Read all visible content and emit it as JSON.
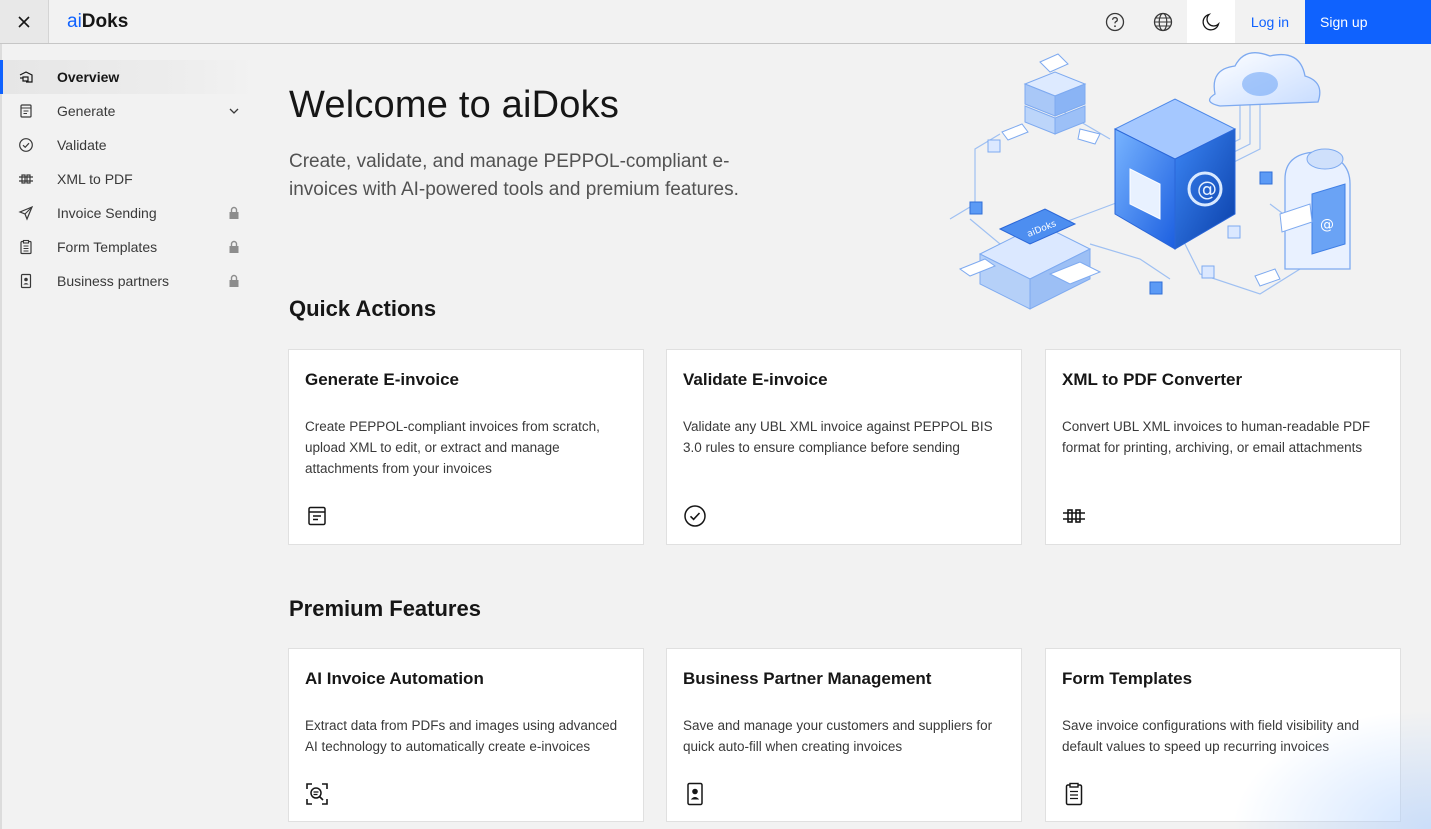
{
  "header": {
    "brand_prefix": "ai",
    "brand_name": "Doks",
    "login_label": "Log in",
    "signup_label": "Sign up",
    "icons": [
      "close-icon",
      "help-icon",
      "globe-icon",
      "moon-icon"
    ]
  },
  "sidebar": {
    "items": [
      {
        "label": "Overview",
        "icon": "overview-icon",
        "active": true
      },
      {
        "label": "Generate",
        "icon": "document-icon",
        "trailing": "chevron-down-icon"
      },
      {
        "label": "Validate",
        "icon": "checkmark-circle-icon"
      },
      {
        "label": "XML to PDF",
        "icon": "convert-icon"
      },
      {
        "label": "Invoice Sending",
        "icon": "send-icon",
        "trailing": "lock-icon"
      },
      {
        "label": "Form Templates",
        "icon": "clipboard-icon",
        "trailing": "lock-icon"
      },
      {
        "label": "Business partners",
        "icon": "contact-card-icon",
        "trailing": "lock-icon"
      }
    ]
  },
  "main": {
    "title": "Welcome to aiDoks",
    "subtitle": "Create, validate, and manage PEPPOL-compliant e-invoices with AI-powered tools and premium features.",
    "quick_actions_title": "Quick Actions",
    "premium_title": "Premium Features",
    "quick_actions": [
      {
        "title": "Generate E-invoice",
        "desc": "Create PEPPOL-compliant invoices from scratch, upload XML to edit, or extract and manage attachments from your invoices",
        "icon": "document-icon"
      },
      {
        "title": "Validate E-invoice",
        "desc": "Validate any UBL XML invoice against PEPPOL BIS 3.0 rules to ensure compliance before sending",
        "icon": "checkmark-circle-icon"
      },
      {
        "title": "XML to PDF Converter",
        "desc": "Convert UBL XML invoices to human-readable PDF format for printing, archiving, or email attachments",
        "icon": "convert-icon"
      }
    ],
    "premium_features": [
      {
        "title": "AI Invoice Automation",
        "desc": "Extract data from PDFs and images using advanced AI technology to automatically create e-invoices",
        "icon": "scan-document-icon"
      },
      {
        "title": "Business Partner Management",
        "desc": "Save and manage your customers and suppliers for quick auto-fill when creating invoices",
        "icon": "contact-card-icon"
      },
      {
        "title": "Form Templates",
        "desc": "Save invoice configurations with field visibility and default values to speed up recurring invoices",
        "icon": "clipboard-icon"
      }
    ],
    "hero_label": "aiDoks"
  },
  "colors": {
    "accent": "#0f62fe",
    "background": "#f2f2f2",
    "card": "#ffffff",
    "text": "#161616"
  }
}
